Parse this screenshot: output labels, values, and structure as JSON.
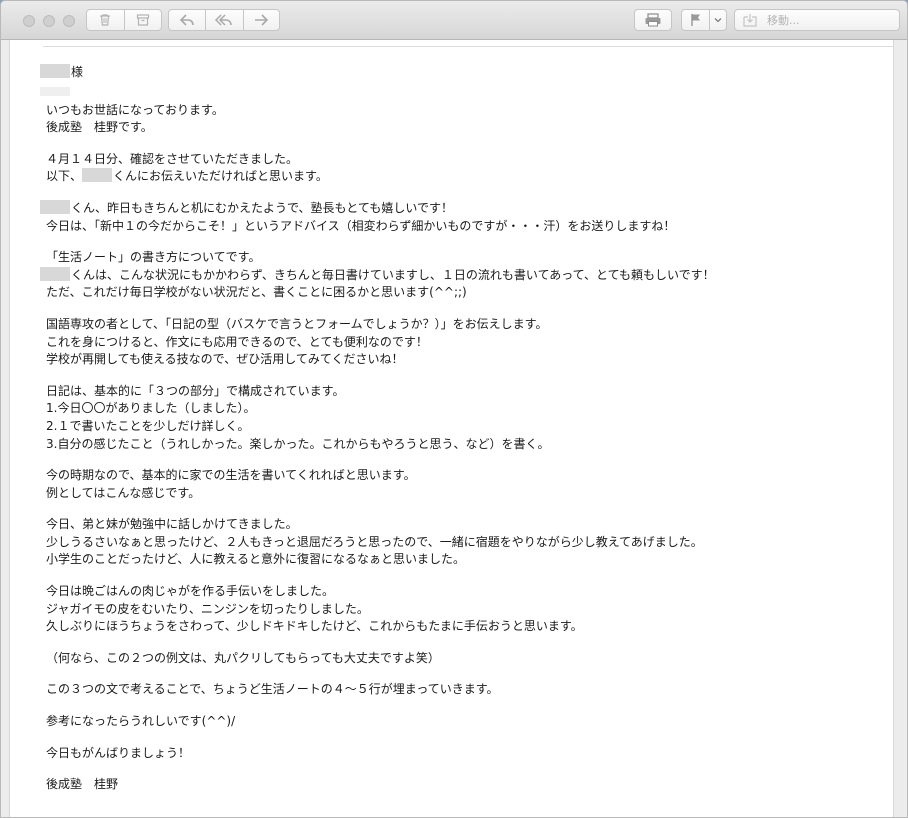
{
  "toolbar": {
    "move_placeholder": "移動..."
  },
  "icons": {
    "trash": "trash-icon",
    "archive": "archive-icon",
    "reply": "reply-icon",
    "reply_all": "reply-all-icon",
    "forward": "forward-icon",
    "print": "print-icon",
    "flag": "flag-icon",
    "chevron": "chevron-down-icon",
    "move": "move-to-folder-icon"
  },
  "email": {
    "salutation": "様",
    "p1": [
      "いつもお世話になっております。",
      "後成塾　桂野です。"
    ],
    "p2_l1": "４月１４日分、確認をさせていただきました。",
    "p2_l2a": "以下、",
    "p2_l2b": "くんにお伝えいただければと思います。",
    "p3_l1": "くん、昨日もきちんと机にむかえたようで、塾長もとても嬉しいです！",
    "p3_l2": "今日は、「新中１の今だからこそ！」というアドバイス（相変わらず細かいものですが・・・汗）をお送りしますね！",
    "p4_l1": "「生活ノート」の書き方についてです。",
    "p4_l2": "くんは、こんな状況にもかかわらず、きちんと毎日書けていますし、１日の流れも書いてあって、とても頼もしいです！",
    "p4_l3": "ただ、これだけ毎日学校がない状況だと、書くことに困るかと思います(^^;;)",
    "p5": [
      "国語専攻の者として、「日記の型（バスケで言うとフォームでしょうか？）」をお伝えします。",
      "これを身につけると、作文にも応用できるので、とても便利なのです！",
      "学校が再開しても使える技なので、ぜひ活用してみてくださいね！"
    ],
    "p6": [
      "日記は、基本的に「３つの部分」で構成されています。",
      "1.今日〇〇がありました（しました）。",
      "2.１で書いたことを少しだけ詳しく。",
      "3.自分の感じたこと（うれしかった。楽しかった。これからもやろうと思う、など）を書く。"
    ],
    "p7": [
      "今の時期なので、基本的に家での生活を書いてくれればと思います。",
      "例としてはこんな感じです。"
    ],
    "p8": [
      "今日、弟と妹が勉強中に話しかけてきました。",
      "少しうるさいなぁと思ったけど、２人もきっと退屈だろうと思ったので、一緒に宿題をやりながら少し教えてあげました。",
      "小学生のことだったけど、人に教えると意外に復習になるなぁと思いました。"
    ],
    "p9": [
      "今日は晩ごはんの肉じゃがを作る手伝いをしました。",
      "ジャガイモの皮をむいたり、ニンジンを切ったりしました。",
      "久しぶりにほうちょうをさわって、少しドキドキしたけど、これからもたまに手伝おうと思います。"
    ],
    "p10": "（何なら、この２つの例文は、丸パクリしてもらっても大丈夫ですよ笑）",
    "p11": "この３つの文で考えることで、ちょうど生活ノートの４～５行が埋まっていきます。",
    "p12": "参考になったらうれしいです(^^)/",
    "p13": "今日もがんばりましょう！",
    "signature": "後成塾　桂野"
  }
}
